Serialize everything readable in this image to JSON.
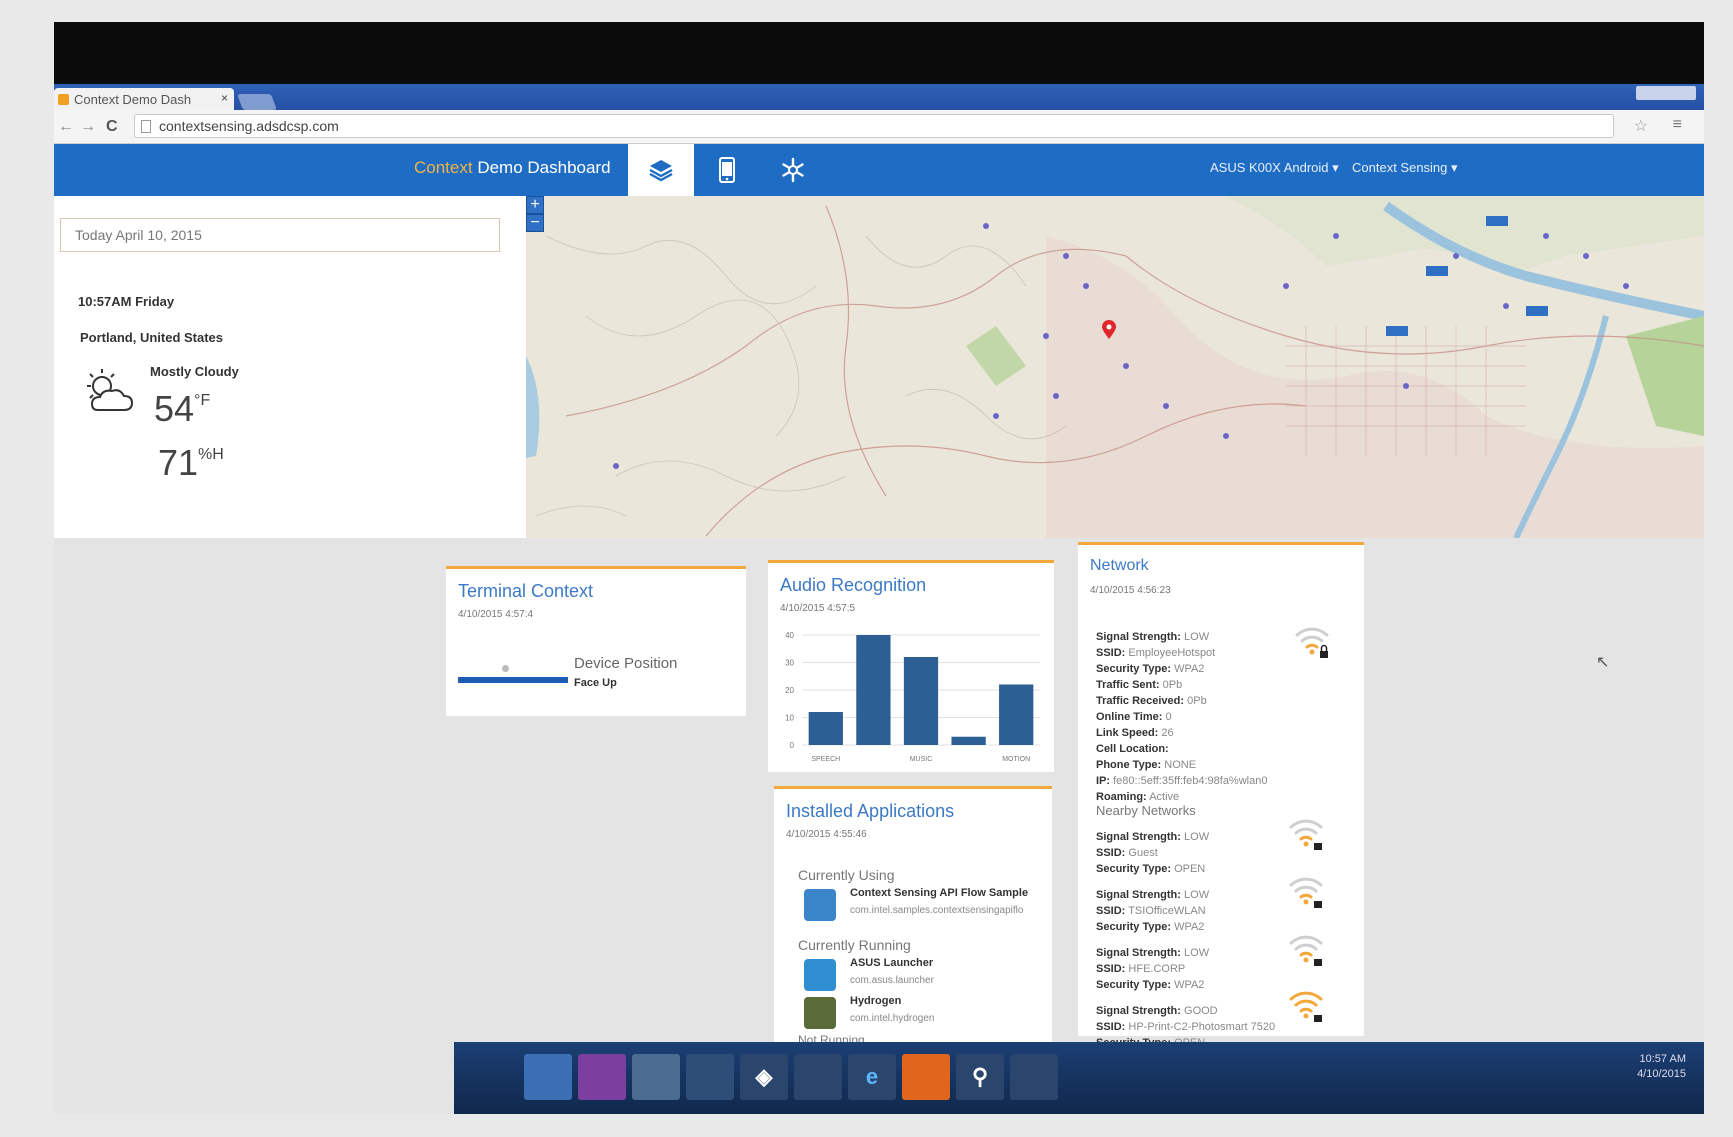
{
  "browser": {
    "tab_title": "Context Demo Dash",
    "tab_close": "×",
    "url": "contextsensing.adsdcsp.com",
    "back": "←",
    "forward": "→",
    "reload": "C",
    "star": "☆",
    "menu": "≡"
  },
  "header": {
    "brand_accent": "Context",
    "brand_rest": " Demo Dashboard",
    "device_dropdown": "ASUS K00X Android ▾",
    "mode_dropdown": "Context Sensing ▾",
    "icons": [
      "layers-icon",
      "phone-icon",
      "snowflake-icon"
    ]
  },
  "info": {
    "date": "Today April 10, 2015",
    "time": "10:57AM Friday",
    "location": "Portland, United States",
    "condition": "Mostly Cloudy",
    "temp": "54",
    "temp_unit": "°F",
    "humidity": "71",
    "humidity_unit": "%H"
  },
  "map": {
    "zoom_in": "+",
    "zoom_out": "−"
  },
  "terminal": {
    "title": "Terminal Context",
    "timestamp": "4/10/2015 4:57:4",
    "position_label": "Device Position",
    "position_value": "Face Up"
  },
  "audio": {
    "title": "Audio Recognition",
    "timestamp": "4/10/2015 4:57:5"
  },
  "chart_data": {
    "type": "bar",
    "categories": [
      "SPEECH",
      "",
      "MUSIC",
      "",
      "MOTION"
    ],
    "values": [
      12,
      40,
      32,
      3,
      22
    ],
    "ylim": [
      0,
      40
    ],
    "yticks": [
      0,
      10,
      20,
      30,
      40
    ],
    "grid": true,
    "color": "#2c5f93"
  },
  "apps": {
    "title": "Installed Applications",
    "timestamp": "4/10/2015 4:55:46",
    "using_label": "Currently Using",
    "using": [
      {
        "name": "Context Sensing API Flow Sample",
        "pkg": "com.intel.samples.contextsensingapiflo"
      }
    ],
    "running_label": "Currently Running",
    "running": [
      {
        "name": "ASUS Launcher",
        "pkg": "com.asus.launcher"
      },
      {
        "name": "Hydrogen",
        "pkg": "com.intel.hydrogen"
      }
    ],
    "not_running_label": "Not Running"
  },
  "network": {
    "title": "Network",
    "timestamp": "4/10/2015 4:56:23",
    "current": [
      {
        "k": "Signal Strength:",
        "v": "LOW"
      },
      {
        "k": "SSID:",
        "v": "EmployeeHotspot"
      },
      {
        "k": "Security Type:",
        "v": "WPA2"
      },
      {
        "k": "Traffic Sent:",
        "v": "0Pb"
      },
      {
        "k": "Traffic Received:",
        "v": "0Pb"
      },
      {
        "k": "Online Time:",
        "v": "0"
      },
      {
        "k": "Link Speed:",
        "v": "26"
      },
      {
        "k": "Cell Location:",
        "v": ""
      },
      {
        "k": "Phone Type:",
        "v": "NONE"
      },
      {
        "k": "IP:",
        "v": "fe80::5eff:35ff:feb4:98fa%wlan0"
      },
      {
        "k": "Roaming:",
        "v": "Active"
      }
    ],
    "nearby_label": "Nearby Networks",
    "nearby": [
      [
        {
          "k": "Signal Strength:",
          "v": "LOW"
        },
        {
          "k": "SSID:",
          "v": "Guest"
        },
        {
          "k": "Security Type:",
          "v": "OPEN"
        }
      ],
      [
        {
          "k": "Signal Strength:",
          "v": "LOW"
        },
        {
          "k": "SSID:",
          "v": "TSIOfficeWLAN"
        },
        {
          "k": "Security Type:",
          "v": "WPA2"
        }
      ],
      [
        {
          "k": "Signal Strength:",
          "v": "LOW"
        },
        {
          "k": "SSID:",
          "v": "HFE.CORP"
        },
        {
          "k": "Security Type:",
          "v": "WPA2"
        }
      ],
      [
        {
          "k": "Signal Strength:",
          "v": "GOOD"
        },
        {
          "k": "SSID:",
          "v": "HP-Print-C2-Photosmart 7520"
        },
        {
          "k": "Security Type:",
          "v": "OPEN"
        }
      ]
    ]
  },
  "taskbar": {
    "time": "10:57 AM",
    "date": "4/10/2015"
  },
  "colors": {
    "header_blue": "#1e6cc4",
    "accent_orange": "#f3a83c",
    "title_blue": "#3c79c6"
  }
}
